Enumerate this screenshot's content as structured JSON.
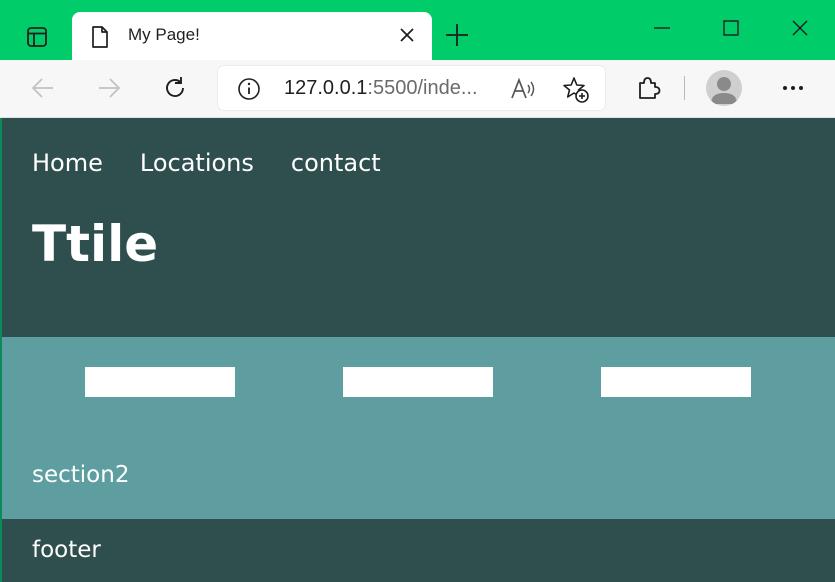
{
  "browser": {
    "tab": {
      "title": "My Page!",
      "icon": "document-icon"
    },
    "address_bar": {
      "url_host": "127.0.0.1",
      "url_rest": ":5500/inde..."
    },
    "colors": {
      "tab_strip": "#00cc6a",
      "toolbar": "#f7f7f7"
    }
  },
  "page": {
    "nav": {
      "items": [
        "Home",
        "Locations",
        "contact"
      ]
    },
    "header": {
      "title": "Ttile"
    },
    "section2": {
      "label": "section2"
    },
    "footer": {
      "label": "footer"
    },
    "colors": {
      "header_bg": "#2f4f4f",
      "section_bg": "#5f9ea0",
      "box_bg": "#ffffff",
      "text": "#ffffff"
    }
  }
}
